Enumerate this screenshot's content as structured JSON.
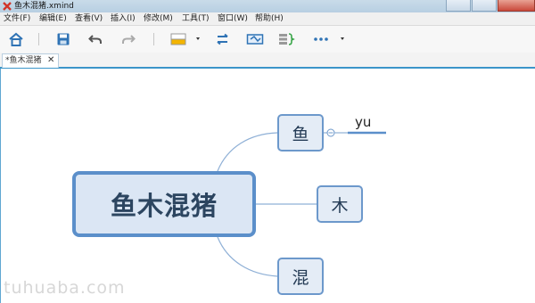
{
  "window": {
    "title": "鱼木混猪.xmind"
  },
  "menu": [
    "文件(F)",
    "编辑(E)",
    "查看(V)",
    "插入(I)",
    "修改(M)",
    "工具(T)",
    "窗口(W)",
    "帮助(H)"
  ],
  "toolbar": [
    "home-icon",
    "save-icon",
    "undo-icon",
    "redo-icon",
    "topic-style-icon",
    "relationship-icon",
    "boundary-icon",
    "summary-icon",
    "more-icon"
  ],
  "tab": {
    "label": "*鱼木混猪",
    "close": "✕"
  },
  "map": {
    "central": "鱼木混猪",
    "topics": [
      "鱼",
      "木",
      "混"
    ],
    "subtopic": "yu"
  },
  "watermark": "tuhuaba.com",
  "colors": {
    "accent": "#3b95c9",
    "topic_border": "#6c98cb",
    "topic_fill": "#e4ecf6"
  }
}
